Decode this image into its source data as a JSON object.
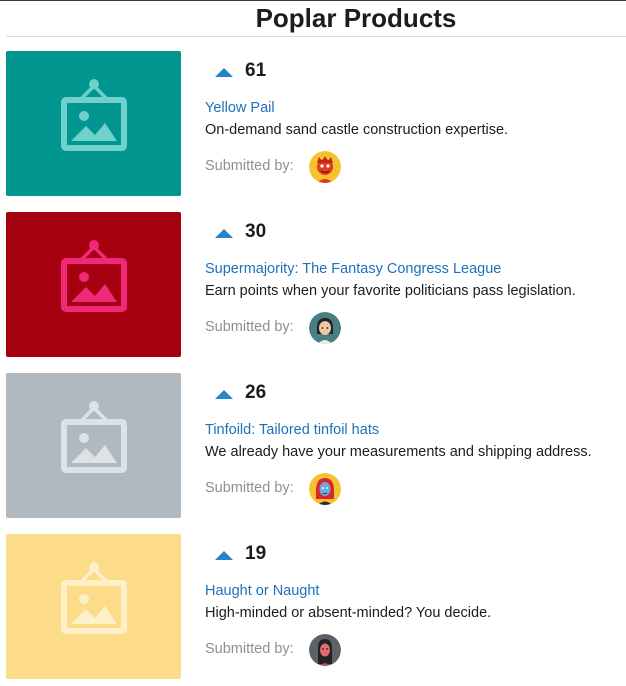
{
  "page": {
    "title": "Poplar Products"
  },
  "colors": {
    "vote_arrow": "#2185d0",
    "link": "#1e70bf",
    "meta_text": "#8f8f8f"
  },
  "products": [
    {
      "votes": "61",
      "title": "Yellow Pail",
      "description": "On-demand sand castle construction expertise.",
      "submitted_label": "Submitted by:",
      "thumb_color": "#00968f",
      "thumb_icon_color": "#6fd0cc",
      "avatar_icon": "avatar-icon-red-character",
      "avatar_bg": "#f6c22d"
    },
    {
      "votes": "30",
      "title": "Supermajority: The Fantasy Congress League",
      "description": "Earn points when your favorite politicians pass legislation.",
      "submitted_label": "Submitted by:",
      "thumb_color": "#a40010",
      "thumb_icon_color": "#f0287a",
      "avatar_icon": "avatar-icon-dark-hair-character",
      "avatar_bg": "#4a7f82"
    },
    {
      "votes": "26",
      "title": "Tinfoild: Tailored tinfoil hats",
      "description": "We already have your measurements and shipping address.",
      "submitted_label": "Submitted by:",
      "thumb_color": "#b0b8c0",
      "thumb_icon_color": "#dde2e6",
      "avatar_icon": "avatar-icon-red-hair-character",
      "avatar_bg": "#f6c22d"
    },
    {
      "votes": "19",
      "title": "Haught or Naught",
      "description": "High-minded or absent-minded? You decide.",
      "submitted_label": "Submitted by:",
      "thumb_color": "#fcdc88",
      "thumb_icon_color": "#fef0c8",
      "avatar_icon": "avatar-icon-long-hair-character",
      "avatar_bg": "#5b6268"
    }
  ]
}
